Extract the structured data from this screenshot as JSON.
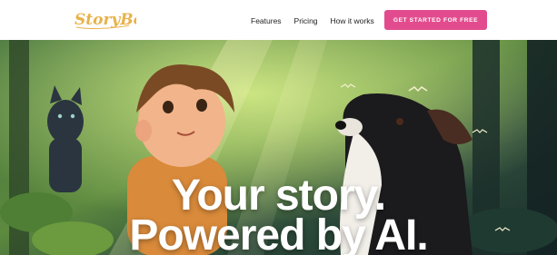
{
  "brand": {
    "name": "StoryBook",
    "color": "#e8b24a"
  },
  "nav": {
    "links": [
      "Features",
      "Pricing",
      "How it works"
    ],
    "cta_label": "GET STARTED FOR FREE",
    "cta_color": "#e24c8e"
  },
  "hero": {
    "headline_line1": "Your story.",
    "headline_line2": "Powered by AI.",
    "illustration": "boy-and-dog-in-forest"
  }
}
